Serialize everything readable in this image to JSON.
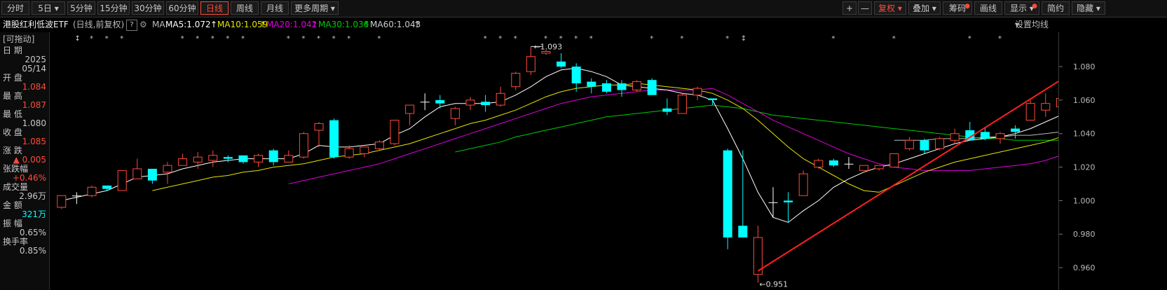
{
  "toolbar": {
    "left": [
      {
        "label": "分时"
      },
      {
        "label": "5日"
      },
      {
        "label": "5分钟"
      },
      {
        "label": "15分钟"
      },
      {
        "label": "30分钟"
      },
      {
        "label": "60分钟"
      },
      {
        "label": "日线"
      },
      {
        "label": "周线"
      },
      {
        "label": "月线"
      },
      {
        "label": "更多周期"
      }
    ],
    "right": [
      {
        "label": "+"
      },
      {
        "label": "—"
      },
      {
        "label": "复权"
      },
      {
        "label": "叠加"
      },
      {
        "label": "筹码"
      },
      {
        "label": "画线"
      },
      {
        "label": "显示"
      },
      {
        "label": "简约"
      },
      {
        "label": "隐藏"
      }
    ],
    "active": "日线"
  },
  "ma_bar": {
    "name": "港股红利低波ETF",
    "period": "(日线,前复权)",
    "help": "?",
    "ma_label": "MA",
    "ma5": "MA5:1.072",
    "ma10": "MA10:1.059",
    "ma20": "MA20:1.042",
    "ma30": "MA30:1.036",
    "ma60": "MA60:1.043",
    "settings": "设置均线"
  },
  "colors": {
    "up": "#ff4a3a",
    "down": "#00ffff",
    "ma5": "#ffffff",
    "ma10": "#e6e600",
    "ma20": "#e000e0",
    "ma30": "#00cc00",
    "ma60": "#bbbbbb",
    "trend": "#ff2020"
  },
  "info": {
    "draggable": "[可拖动]",
    "date_label": "日  期",
    "date_year": "2025",
    "date_md": "05/14",
    "open_label": "开  盘",
    "open": "1.084",
    "high_label": "最  高",
    "high": "1.087",
    "low_label": "最  低",
    "low": "1.080",
    "close_label": "收  盘",
    "close": "1.085",
    "change_label": "涨  跌",
    "change": "▲ 0.005",
    "pct_label": "张跌幅",
    "pct": "+0.46%",
    "vol_label": "成交量",
    "vol": "2.96万",
    "amt_label": "金  额",
    "amt": "321万",
    "amp_label": "振  幅",
    "amp": "0.65%",
    "turn_label": "换手率",
    "turn": "0.85%"
  },
  "chart_data": {
    "type": "candlestick",
    "y_ticks": [
      "1.080",
      "1.060",
      "1.040",
      "1.020",
      "1.000",
      "0.980",
      "0.960"
    ],
    "ylim": [
      0.95,
      1.098
    ],
    "annotations": {
      "high": "1.093",
      "low": "0.951"
    },
    "candles": [
      {
        "o": 0.996,
        "h": 1.003,
        "l": 0.995,
        "c": 1.003
      },
      {
        "o": 1.003,
        "h": 1.005,
        "l": 0.998,
        "c": 1.003
      },
      {
        "o": 1.003,
        "h": 1.009,
        "l": 1.002,
        "c": 1.008
      },
      {
        "o": 1.009,
        "h": 1.009,
        "l": 1.006,
        "c": 1.007
      },
      {
        "o": 1.006,
        "h": 1.018,
        "l": 1.006,
        "c": 1.018
      },
      {
        "o": 1.013,
        "h": 1.025,
        "l": 1.013,
        "c": 1.019
      },
      {
        "o": 1.019,
        "h": 1.019,
        "l": 1.01,
        "c": 1.012
      },
      {
        "o": 1.017,
        "h": 1.023,
        "l": 1.01,
        "c": 1.021
      },
      {
        "o": 1.021,
        "h": 1.028,
        "l": 1.021,
        "c": 1.025
      },
      {
        "o": 1.023,
        "h": 1.029,
        "l": 1.019,
        "c": 1.026
      },
      {
        "o": 1.024,
        "h": 1.03,
        "l": 1.02,
        "c": 1.027
      },
      {
        "o": 1.026,
        "h": 1.027,
        "l": 1.023,
        "c": 1.025
      },
      {
        "o": 1.027,
        "h": 1.027,
        "l": 1.022,
        "c": 1.023
      },
      {
        "o": 1.023,
        "h": 1.028,
        "l": 1.02,
        "c": 1.027
      },
      {
        "o": 1.03,
        "h": 1.031,
        "l": 1.021,
        "c": 1.023
      },
      {
        "o": 1.023,
        "h": 1.03,
        "l": 1.023,
        "c": 1.027
      },
      {
        "o": 1.026,
        "h": 1.041,
        "l": 1.025,
        "c": 1.04
      },
      {
        "o": 1.042,
        "h": 1.047,
        "l": 1.032,
        "c": 1.046
      },
      {
        "o": 1.048,
        "h": 1.049,
        "l": 1.025,
        "c": 1.026
      },
      {
        "o": 1.026,
        "h": 1.033,
        "l": 1.025,
        "c": 1.031
      },
      {
        "o": 1.028,
        "h": 1.032,
        "l": 1.026,
        "c": 1.032
      },
      {
        "o": 1.031,
        "h": 1.036,
        "l": 1.03,
        "c": 1.035
      },
      {
        "o": 1.034,
        "h": 1.048,
        "l": 1.033,
        "c": 1.048
      },
      {
        "o": 1.052,
        "h": 1.057,
        "l": 1.045,
        "c": 1.057
      },
      {
        "o": 1.059,
        "h": 1.064,
        "l": 1.054,
        "c": 1.059
      },
      {
        "o": 1.06,
        "h": 1.063,
        "l": 1.055,
        "c": 1.058
      },
      {
        "o": 1.049,
        "h": 1.056,
        "l": 1.045,
        "c": 1.055
      },
      {
        "o": 1.057,
        "h": 1.062,
        "l": 1.054,
        "c": 1.06
      },
      {
        "o": 1.059,
        "h": 1.063,
        "l": 1.053,
        "c": 1.057
      },
      {
        "o": 1.057,
        "h": 1.068,
        "l": 1.056,
        "c": 1.064
      },
      {
        "o": 1.068,
        "h": 1.077,
        "l": 1.066,
        "c": 1.076
      },
      {
        "o": 1.077,
        "h": 1.092,
        "l": 1.075,
        "c": 1.086
      },
      {
        "o": 1.088,
        "h": 1.09,
        "l": 1.087,
        "c": 1.089
      },
      {
        "o": 1.083,
        "h": 1.088,
        "l": 1.079,
        "c": 1.08
      },
      {
        "o": 1.08,
        "h": 1.082,
        "l": 1.065,
        "c": 1.07
      },
      {
        "o": 1.071,
        "h": 1.073,
        "l": 1.064,
        "c": 1.068
      },
      {
        "o": 1.07,
        "h": 1.072,
        "l": 1.064,
        "c": 1.065
      },
      {
        "o": 1.07,
        "h": 1.072,
        "l": 1.062,
        "c": 1.066
      },
      {
        "o": 1.066,
        "h": 1.072,
        "l": 1.065,
        "c": 1.071
      },
      {
        "o": 1.072,
        "h": 1.073,
        "l": 1.063,
        "c": 1.063
      },
      {
        "o": 1.055,
        "h": 1.061,
        "l": 1.051,
        "c": 1.053
      },
      {
        "o": 1.052,
        "h": 1.064,
        "l": 1.052,
        "c": 1.063
      },
      {
        "o": 1.063,
        "h": 1.068,
        "l": 1.06,
        "c": 1.067
      },
      {
        "o": 1.061,
        "h": 1.061,
        "l": 1.057,
        "c": 1.06
      },
      {
        "o": 1.03,
        "h": 1.031,
        "l": 0.971,
        "c": 0.978
      },
      {
        "o": 0.985,
        "h": 1.03,
        "l": 0.979,
        "c": 0.978
      },
      {
        "o": 0.956,
        "h": 0.985,
        "l": 0.951,
        "c": 0.978
      },
      {
        "o": 0.999,
        "h": 1.008,
        "l": 0.99,
        "c": 0.999
      },
      {
        "o": 1.0,
        "h": 1.005,
        "l": 0.987,
        "c": 0.999
      },
      {
        "o": 1.003,
        "h": 1.018,
        "l": 1.003,
        "c": 1.016
      },
      {
        "o": 1.02,
        "h": 1.025,
        "l": 1.019,
        "c": 1.024
      },
      {
        "o": 1.024,
        "h": 1.025,
        "l": 1.02,
        "c": 1.021
      },
      {
        "o": 1.022,
        "h": 1.026,
        "l": 1.019,
        "c": 1.022
      },
      {
        "o": 1.018,
        "h": 1.021,
        "l": 1.018,
        "c": 1.021
      },
      {
        "o": 1.019,
        "h": 1.021,
        "l": 1.018,
        "c": 1.021
      },
      {
        "o": 1.02,
        "h": 1.028,
        "l": 1.02,
        "c": 1.028
      },
      {
        "o": 1.031,
        "h": 1.038,
        "l": 1.03,
        "c": 1.036
      },
      {
        "o": 1.036,
        "h": 1.037,
        "l": 1.028,
        "c": 1.03
      },
      {
        "o": 1.031,
        "h": 1.038,
        "l": 1.03,
        "c": 1.037
      },
      {
        "o": 1.036,
        "h": 1.043,
        "l": 1.034,
        "c": 1.04
      },
      {
        "o": 1.042,
        "h": 1.047,
        "l": 1.038,
        "c": 1.036
      },
      {
        "o": 1.041,
        "h": 1.044,
        "l": 1.036,
        "c": 1.037
      },
      {
        "o": 1.037,
        "h": 1.041,
        "l": 1.034,
        "c": 1.04
      },
      {
        "o": 1.043,
        "h": 1.045,
        "l": 1.037,
        "c": 1.041
      },
      {
        "o": 1.048,
        "h": 1.06,
        "l": 1.048,
        "c": 1.058
      },
      {
        "o": 1.054,
        "h": 1.064,
        "l": 1.05,
        "c": 1.058
      },
      {
        "o": 1.056,
        "h": 1.066,
        "l": 1.056,
        "c": 1.061
      },
      {
        "o": 1.064,
        "h": 1.076,
        "l": 1.061,
        "c": 1.075
      },
      {
        "o": 1.076,
        "h": 1.086,
        "l": 1.075,
        "c": 1.083
      },
      {
        "o": 1.084,
        "h": 1.087,
        "l": 1.08,
        "c": 1.085
      }
    ],
    "ma_lines": {
      "ma5": [
        1.0,
        1.002,
        1.004,
        1.006,
        1.01,
        1.014,
        1.015,
        1.016,
        1.019,
        1.021,
        1.023,
        1.024,
        1.025,
        1.025,
        1.025,
        1.025,
        1.028,
        1.033,
        1.032,
        1.032,
        1.033,
        1.034,
        1.039,
        1.043,
        1.05,
        1.056,
        1.058,
        1.058,
        1.058,
        1.059,
        1.063,
        1.068,
        1.074,
        1.078,
        1.079,
        1.077,
        1.074,
        1.069,
        1.068,
        1.067,
        1.066,
        1.064,
        1.063,
        1.06,
        1.043,
        1.025,
        1.005,
        0.99,
        0.987,
        0.994,
        1.0,
        1.008,
        1.013,
        1.017,
        1.02,
        1.022,
        1.025,
        1.028,
        1.031,
        1.034,
        1.036,
        1.037,
        1.038,
        1.04,
        1.043,
        1.047,
        1.051,
        1.055,
        1.061,
        1.072
      ],
      "ma10": [
        null,
        null,
        null,
        null,
        null,
        null,
        1.006,
        1.008,
        1.01,
        1.012,
        1.014,
        1.015,
        1.017,
        1.018,
        1.02,
        1.021,
        1.022,
        1.024,
        1.026,
        1.027,
        1.028,
        1.03,
        1.032,
        1.034,
        1.037,
        1.04,
        1.043,
        1.046,
        1.048,
        1.051,
        1.054,
        1.058,
        1.062,
        1.065,
        1.067,
        1.068,
        1.069,
        1.069,
        1.07,
        1.069,
        1.068,
        1.067,
        1.066,
        1.064,
        1.06,
        1.055,
        1.048,
        1.04,
        1.032,
        1.025,
        1.02,
        1.015,
        1.01,
        1.006,
        1.005,
        1.009,
        1.013,
        1.017,
        1.02,
        1.023,
        1.025,
        1.027,
        1.029,
        1.031,
        1.033,
        1.035,
        1.038,
        1.042,
        1.047,
        1.059
      ],
      "ma20": [
        null,
        null,
        null,
        null,
        null,
        null,
        null,
        null,
        null,
        null,
        null,
        null,
        null,
        null,
        null,
        1.01,
        1.012,
        1.014,
        1.016,
        1.018,
        1.02,
        1.022,
        1.025,
        1.028,
        1.031,
        1.034,
        1.037,
        1.04,
        1.043,
        1.046,
        1.049,
        1.052,
        1.055,
        1.058,
        1.06,
        1.062,
        1.063,
        1.064,
        1.065,
        1.066,
        1.066,
        1.066,
        1.066,
        1.067,
        1.063,
        1.058,
        1.053,
        1.048,
        1.044,
        1.04,
        1.036,
        1.032,
        1.028,
        1.025,
        1.022,
        1.02,
        1.019,
        1.018,
        1.018,
        1.018,
        1.018,
        1.019,
        1.02,
        1.021,
        1.022,
        1.024,
        1.027,
        1.031,
        1.036,
        1.042
      ],
      "ma30": [
        null,
        null,
        null,
        null,
        null,
        null,
        null,
        null,
        null,
        null,
        null,
        null,
        null,
        null,
        null,
        null,
        null,
        null,
        null,
        null,
        null,
        null,
        null,
        null,
        null,
        null,
        1.029,
        1.031,
        1.033,
        1.035,
        1.038,
        1.04,
        1.042,
        1.044,
        1.046,
        1.048,
        1.05,
        1.051,
        1.052,
        1.053,
        1.054,
        1.055,
        1.056,
        1.057,
        1.056,
        1.055,
        1.053,
        1.051,
        1.05,
        1.049,
        1.048,
        1.047,
        1.046,
        1.045,
        1.044,
        1.043,
        1.042,
        1.041,
        1.04,
        1.039,
        1.038,
        1.037,
        1.037,
        1.036,
        1.036,
        1.036,
        1.036,
        1.036,
        1.036,
        1.036
      ],
      "ma60": [
        null,
        null,
        null,
        null,
        null,
        null,
        null,
        null,
        null,
        null,
        null,
        null,
        null,
        null,
        null,
        null,
        null,
        null,
        null,
        null,
        null,
        null,
        null,
        null,
        null,
        null,
        null,
        null,
        null,
        null,
        null,
        null,
        null,
        null,
        null,
        null,
        null,
        null,
        null,
        null,
        null,
        null,
        null,
        null,
        null,
        null,
        null,
        null,
        null,
        null,
        null,
        null,
        null,
        null,
        null,
        1.036,
        1.036,
        1.036,
        1.037,
        1.037,
        1.037,
        1.038,
        1.038,
        1.039,
        1.039,
        1.04,
        1.041,
        1.041,
        1.042,
        1.043
      ]
    },
    "trend_line": {
      "from": [
        46,
        0.958
      ],
      "to": [
        68,
        1.083
      ]
    }
  }
}
